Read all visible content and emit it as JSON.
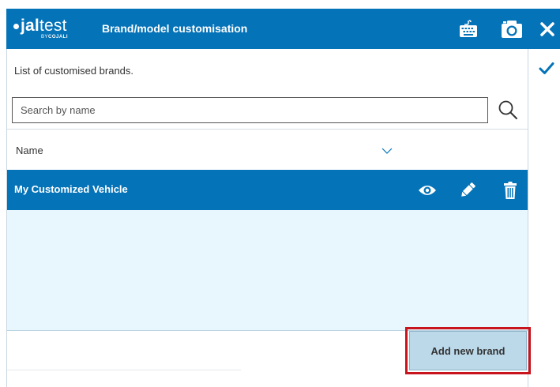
{
  "header": {
    "logo_brand": "jaltest",
    "logo_brand_bold": "jal",
    "logo_brand_light": "test",
    "logo_sub": "BY COJALI",
    "logo_sub_by": "BY",
    "logo_sub_name": "COJALI",
    "title": "Brand/model customisation",
    "icons": [
      "keyboard-icon",
      "camera-icon",
      "close-icon"
    ]
  },
  "side": {
    "icons": [
      "checkmark-icon"
    ]
  },
  "panel": {
    "label": "List of customised brands.",
    "search": {
      "placeholder": "Search by name",
      "value": ""
    },
    "column_header": "Name",
    "rows": [
      {
        "name": "My Customized Vehicle",
        "selected": true,
        "actions": [
          "eye-icon",
          "pencil-icon",
          "trash-icon"
        ]
      }
    ],
    "add_button_label": "Add new brand"
  },
  "colors": {
    "primary": "#0573b8",
    "list_background": "#e8f6fd",
    "button_background": "#bcd9ea",
    "highlight_border": "#c8141c"
  }
}
